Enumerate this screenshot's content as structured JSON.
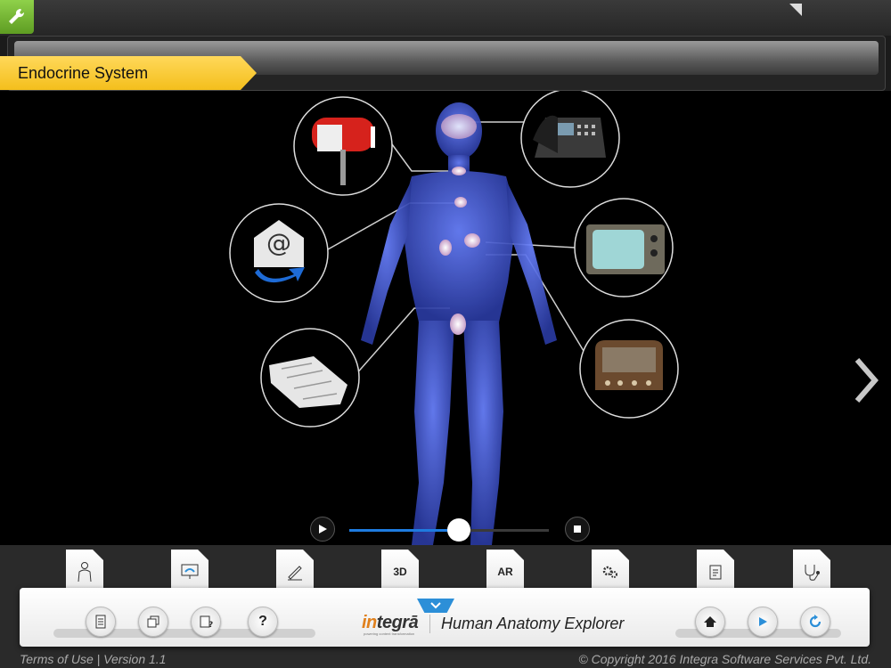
{
  "header": {
    "title": "Endocrine System"
  },
  "illustration": {
    "subject": "human-body-endocrine",
    "analogy_icons": [
      "mailbox-icon",
      "telephone-icon",
      "email-icon",
      "television-icon",
      "newspaper-icon",
      "radio-icon"
    ]
  },
  "player": {
    "progress": 0.55
  },
  "toolbar": {
    "cards": [
      {
        "icon": "body-icon",
        "label": ""
      },
      {
        "icon": "monitor-icon",
        "label": ""
      },
      {
        "icon": "edit-icon",
        "label": ""
      },
      {
        "icon": "3d-icon",
        "label": "3D"
      },
      {
        "icon": "ar-icon",
        "label": "AR"
      },
      {
        "icon": "settings-icon",
        "label": ""
      },
      {
        "icon": "notes-icon",
        "label": ""
      },
      {
        "icon": "stethoscope-icon",
        "label": ""
      }
    ],
    "left_buttons": [
      "document-icon",
      "copy-icon",
      "quiz-icon",
      "help-icon"
    ],
    "help_label": "?",
    "right_buttons": [
      "home-icon",
      "play-icon",
      "refresh-icon"
    ]
  },
  "brand": {
    "logo_prefix": "in",
    "logo_rest": "tegrā",
    "logo_tagline": "powering content transformation",
    "app_name": "Human Anatomy Explorer"
  },
  "footer": {
    "terms": "Terms of Use",
    "version": "Version 1.1",
    "copyright": "© Copyright 2016 Integra Software Services Pvt. Ltd."
  },
  "colors": {
    "title_tab": "#f4bf1c",
    "accent_blue": "#2c8fd8",
    "body_blue": "#3b52c4",
    "tool_green": "#6cb52d"
  }
}
